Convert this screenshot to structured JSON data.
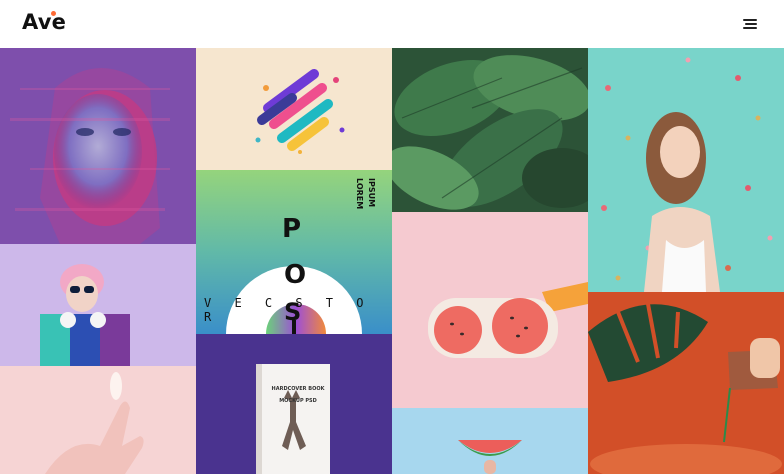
{
  "header": {
    "logo_text": "Ave",
    "menu_icon": "hamburger-menu-icon"
  },
  "portfolio": {
    "poster": {
      "letters_top": "P",
      "letters_mid": "O",
      "letters_bot": "S",
      "vector_word": "V E C S T O R",
      "lorem_line1": "LOREM",
      "lorem_line2": "IPSUM"
    },
    "book": {
      "title_line1": "HARDCOVER BOOK",
      "title_line2": "MOCKUP PSD"
    }
  },
  "colors": {
    "accent": "#ff6b35",
    "teal": "#6fd3c8",
    "purple": "#5b3a9a",
    "peach": "#f6e6cf",
    "pink": "#f4c9cf",
    "orange": "#d4542b"
  }
}
